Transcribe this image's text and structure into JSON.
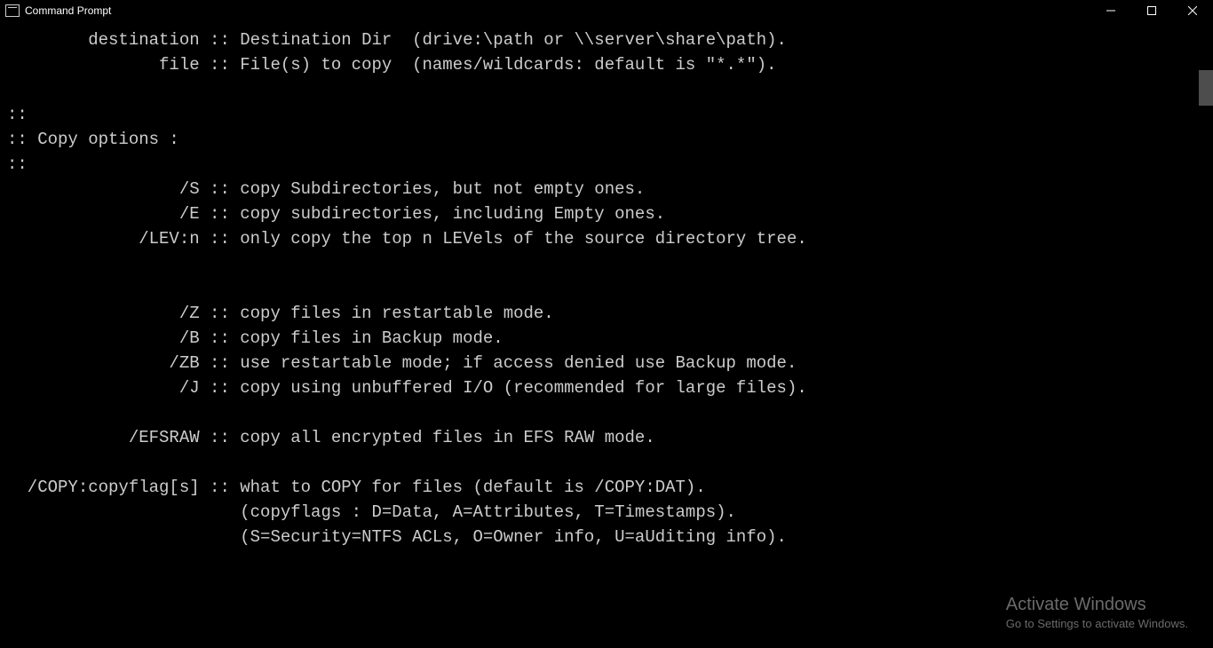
{
  "titlebar": {
    "title": "Command Prompt"
  },
  "terminal": {
    "lines": [
      "        destination :: Destination Dir  (drive:\\path or \\\\server\\share\\path).",
      "               file :: File(s) to copy  (names/wildcards: default is \"*.*\").",
      "",
      "::",
      ":: Copy options :",
      "::",
      "                 /S :: copy Subdirectories, but not empty ones.",
      "                 /E :: copy subdirectories, including Empty ones.",
      "             /LEV:n :: only copy the top n LEVels of the source directory tree.",
      "",
      "",
      "                 /Z :: copy files in restartable mode.",
      "                 /B :: copy files in Backup mode.",
      "                /ZB :: use restartable mode; if access denied use Backup mode.",
      "                 /J :: copy using unbuffered I/O (recommended for large files).",
      "",
      "            /EFSRAW :: copy all encrypted files in EFS RAW mode.",
      "",
      "  /COPY:copyflag[s] :: what to COPY for files (default is /COPY:DAT).",
      "                       (copyflags : D=Data, A=Attributes, T=Timestamps).",
      "                       (S=Security=NTFS ACLs, O=Owner info, U=aUditing info).",
      ""
    ]
  },
  "watermark": {
    "title": "Activate Windows",
    "subtitle": "Go to Settings to activate Windows."
  }
}
